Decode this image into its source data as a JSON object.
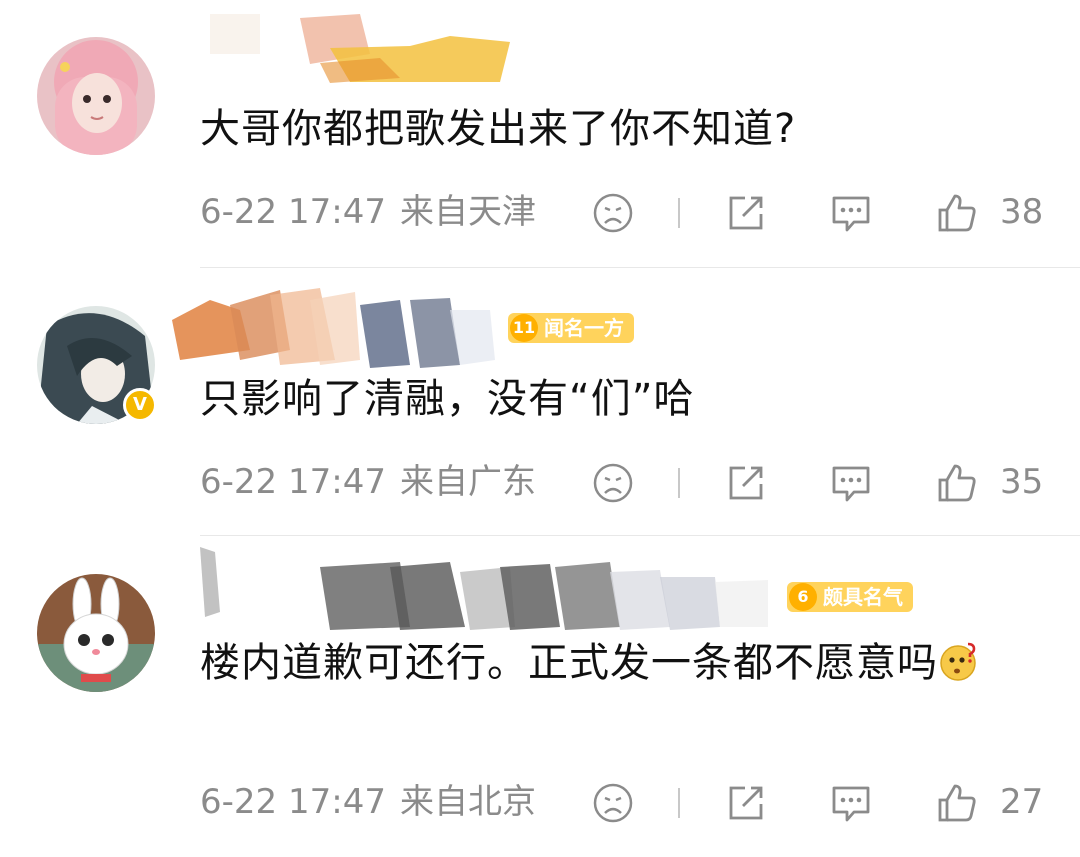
{
  "comments": [
    {
      "text": "大哥你都把歌发出来了你不知道?",
      "time": "6-22 17:47",
      "location": "来自天津",
      "likes": "38",
      "verified": false
    },
    {
      "text": "只影响了清融，没有“们”哈",
      "time": "6-22 17:47",
      "location": "来自广东",
      "likes": "35",
      "verified": true,
      "verified_mark": "V",
      "badge": {
        "level": "11",
        "label": "闻名一方"
      }
    },
    {
      "text": "楼内道歉可还行。正式发一条都不愿意吗",
      "time": "6-22 17:47",
      "location": "来自北京",
      "likes": "27",
      "verified": false,
      "badge": {
        "level": "6",
        "label": "颇具名气"
      },
      "trailing_emoji": "thinking-emoji"
    }
  ],
  "icons": {
    "dislike": "sad-face-icon",
    "share": "share-icon",
    "reply": "comment-bubble-icon",
    "like": "thumbs-up-icon"
  },
  "colors": {
    "meta_text": "#8b8b8b",
    "badge_bg": "#ffd35c",
    "verified": "#f5b800"
  }
}
